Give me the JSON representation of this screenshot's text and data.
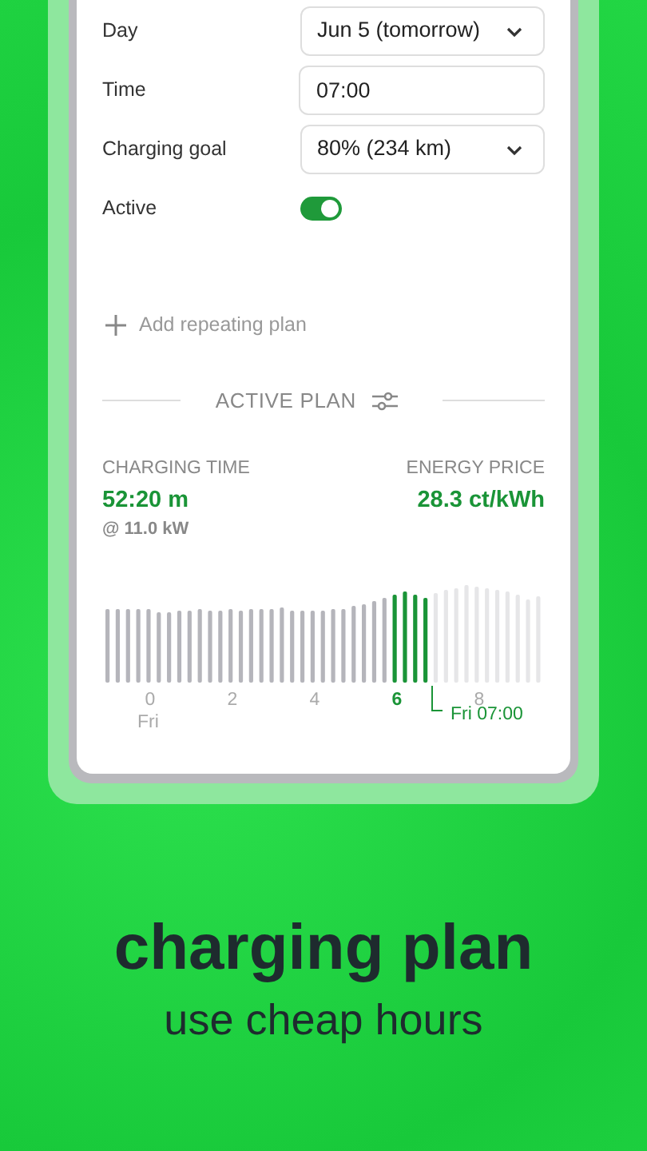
{
  "form": [
    {
      "kind": "select",
      "label": "Day",
      "value": "Jun 5 (tomorrow)"
    },
    {
      "kind": "input",
      "label": "Time",
      "value": "07:00"
    },
    {
      "kind": "select",
      "label": "Charging goal",
      "value": "80% (234 km)"
    },
    {
      "kind": "toggle",
      "label": "Active",
      "on": true
    }
  ],
  "add_button": "Add repeating plan",
  "section_title": "ACTIVE PLAN",
  "stats": [
    {
      "label": "CHARGING TIME",
      "value": "52:20 m",
      "note": "@ 11.0 kW"
    },
    {
      "label": "ENERGY PRICE",
      "value": "28.3 ct/kWh"
    }
  ],
  "chart": {
    "ticks": [
      {
        "label": "0",
        "selected": false
      },
      {
        "label": "2",
        "selected": false
      },
      {
        "label": "4",
        "selected": false
      },
      {
        "label": "6",
        "selected": true
      },
      {
        "label": "8",
        "selected": false
      }
    ],
    "day_label": "Fri",
    "end_label": "Fri 07:00"
  },
  "headline": "charging plan",
  "subline": "use cheap hours"
}
